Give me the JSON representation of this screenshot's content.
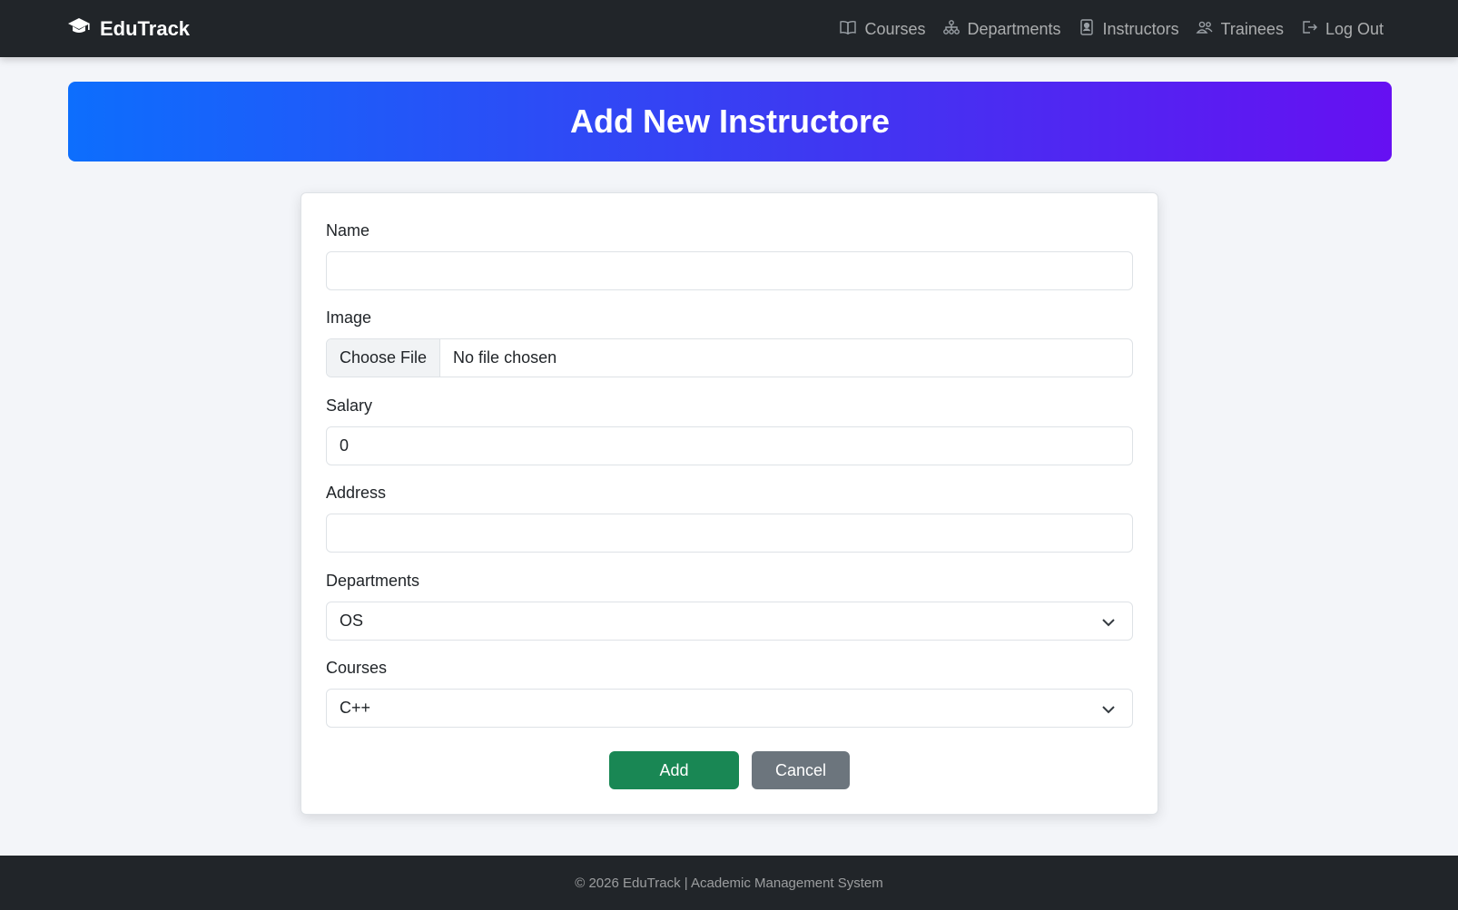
{
  "navbar": {
    "brand": "EduTrack",
    "links": [
      {
        "label": "Courses",
        "icon": "book-icon"
      },
      {
        "label": "Departments",
        "icon": "sitemap-icon"
      },
      {
        "label": "Instructors",
        "icon": "badge-icon"
      },
      {
        "label": "Trainees",
        "icon": "people-icon"
      },
      {
        "label": "Log Out",
        "icon": "logout-icon"
      }
    ]
  },
  "banner": {
    "title": "Add New Instructore"
  },
  "form": {
    "name": {
      "label": "Name",
      "value": ""
    },
    "image": {
      "label": "Image",
      "button": "Choose File",
      "status": "No file chosen"
    },
    "salary": {
      "label": "Salary",
      "value": "0"
    },
    "address": {
      "label": "Address",
      "value": ""
    },
    "departments": {
      "label": "Departments",
      "selected": "OS"
    },
    "courses": {
      "label": "Courses",
      "selected": "C++"
    },
    "add_label": "Add",
    "cancel_label": "Cancel"
  },
  "footer": {
    "text": "© 2026 EduTrack | Academic Management System"
  },
  "colors": {
    "navbar_bg": "#212529",
    "banner_start": "#0d6efd",
    "banner_end": "#6610f2",
    "add_button": "#198754",
    "cancel_button": "#6c757d",
    "page_bg": "#f3f5f9"
  }
}
